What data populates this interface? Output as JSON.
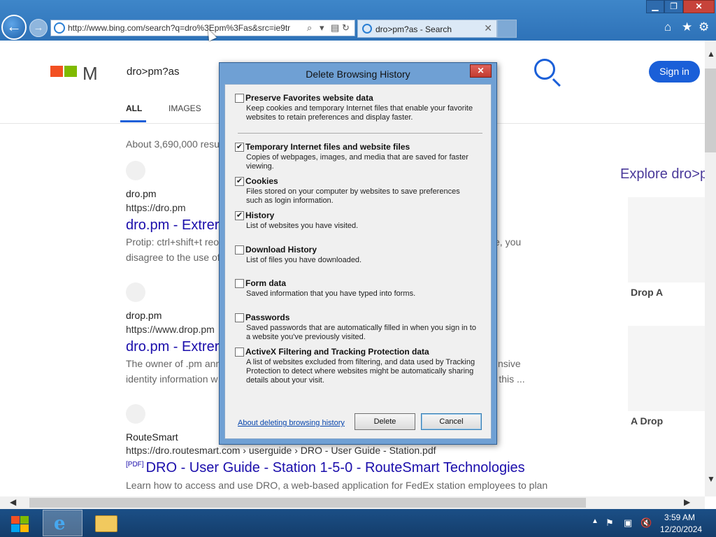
{
  "browser": {
    "address_url": "http://www.bing.com/search?q=dro%3Epm%3Fas&src=ie9tr",
    "tab_title": "dro>pm?as - Search",
    "window_buttons": {
      "minimize": "▁",
      "maximize": "❐",
      "close": "✕"
    }
  },
  "page": {
    "search_query": "dro>pm?as",
    "signin_label": "Sign in",
    "nav": {
      "all": "ALL",
      "images": "IMAGES"
    },
    "results_count": "About 3,690,000 resu",
    "explore_heading": "Explore dro>p",
    "side_cards": [
      "Drop A",
      "A Drop"
    ],
    "results": [
      {
        "site": "dro.pm",
        "url": "https://dro.pm",
        "title": "dro.pm - Extrer",
        "snippet_1": "Protip: ctrl+shift+t reo",
        "snippet_1_right": "ite, you",
        "snippet_2": "disagree to the use of"
      },
      {
        "site": "drop.pm",
        "url": "https://www.drop.pm",
        "title": "dro.pm - Extrer",
        "snippet_1": "The owner of .pm ann",
        "snippet_1_right": "nsive",
        "snippet_2": "identity information w",
        "snippet_2_right": "re this ..."
      },
      {
        "site": "RouteSmart",
        "url": "https://dro.routesmart.com › userguide › DRO - User Guide - Station.pdf",
        "pdf_badge": "[PDF]",
        "title": "DRO - User Guide - Station 1-5-0 - RouteSmart Technologies",
        "snippet_1": "Learn how to access and use DRO, a web-based application for FedEx station employees to plan"
      }
    ]
  },
  "dialog": {
    "title": "Delete Browsing History",
    "close_label": "✕",
    "options": [
      {
        "title": "Preserve Favorites website data",
        "checked": false,
        "desc": "Keep cookies and temporary Internet files that enable your favorite websites to retain preferences and display faster."
      },
      {
        "title": "Temporary Internet files and website files",
        "checked": true,
        "desc": "Copies of webpages, images, and media that are saved for faster viewing."
      },
      {
        "title": "Cookies",
        "checked": true,
        "desc": "Files stored on your computer by websites to save preferences such as login information."
      },
      {
        "title": "History",
        "checked": true,
        "desc": "List of websites you have visited."
      },
      {
        "title": "Download History",
        "checked": false,
        "desc": "List of files you have downloaded."
      },
      {
        "title": "Form data",
        "checked": false,
        "desc": "Saved information that you have typed into forms."
      },
      {
        "title": "Passwords",
        "checked": false,
        "desc": "Saved passwords that are automatically filled in when you sign in to a website you've previously visited."
      },
      {
        "title": "ActiveX Filtering and Tracking Protection data",
        "checked": false,
        "desc": "A list of websites excluded from filtering, and data used by Tracking Protection to detect where websites might be automatically sharing details about your visit."
      }
    ],
    "about_link": "About deleting browsing history",
    "delete_label": "Delete",
    "cancel_label": "Cancel"
  },
  "taskbar": {
    "time": "3:59 AM",
    "date": "12/20/2024"
  }
}
